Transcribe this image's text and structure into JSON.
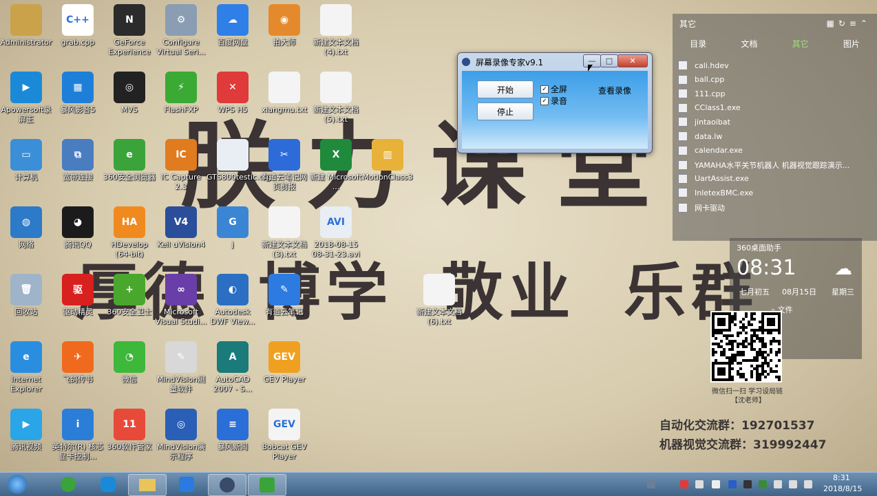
{
  "wallpaper": {
    "slogan_top": "朕力课堂",
    "slogan_bottom": "厚德 博学 敬业 乐群",
    "group1": "自动化交流群：192701537",
    "group2": "机器视觉交流群：319992447"
  },
  "desktop_icons": [
    {
      "label": "Administrator",
      "color": "#c9a24a",
      "glyph": ""
    },
    {
      "label": "grab.cpp",
      "color": "#ffffff",
      "glyph": "C++"
    },
    {
      "label": "GeForce Experience",
      "color": "#2b2b2b",
      "glyph": "N"
    },
    {
      "label": "Configure Virtual Seri...",
      "color": "#8a9db3",
      "glyph": "⚙"
    },
    {
      "label": "百度网盘",
      "color": "#2f7fe8",
      "glyph": "☁"
    },
    {
      "label": "拍大师",
      "color": "#e58a2c",
      "glyph": "◉"
    },
    {
      "label": "新建文本文档 (4).txt",
      "color": "#f4f4f4",
      "glyph": ""
    },
    {
      "label": "Apowersoft录屏王",
      "color": "#1a8ad8",
      "glyph": "▶"
    },
    {
      "label": "暴风影音5",
      "color": "#1e7fd9",
      "glyph": "▦"
    },
    {
      "label": "MVS",
      "color": "#222222",
      "glyph": "◎"
    },
    {
      "label": "FlashFXP",
      "color": "#3aaa35",
      "glyph": "⚡"
    },
    {
      "label": "WPS H5",
      "color": "#e03a3a",
      "glyph": "✕"
    },
    {
      "label": "xiangmu.txt",
      "color": "#f4f4f4",
      "glyph": ""
    },
    {
      "label": "新建文本文档 (5).txt",
      "color": "#f4f4f4",
      "glyph": ""
    },
    {
      "label": "计算机",
      "color": "#3b8fd8",
      "glyph": "▭"
    },
    {
      "label": "宽带连接",
      "color": "#4a7cc0",
      "glyph": "⧉"
    },
    {
      "label": "360安全浏览器",
      "color": "#3aa43a",
      "glyph": "e"
    },
    {
      "label": "IC Capture 2.3",
      "color": "#e07b1f",
      "glyph": "IC"
    },
    {
      "label": "GTS800testic.cfg",
      "color": "#e8eef4",
      "glyph": ""
    },
    {
      "label": "有道云笔记网页剪报",
      "color": "#2d6bd8",
      "glyph": "✂"
    },
    {
      "label": "新建 Microsoft ...",
      "color": "#1f8a3b",
      "glyph": "X"
    },
    {
      "label": "MotionClass3",
      "color": "#e8b23a",
      "glyph": "▥"
    },
    {
      "label": "网络",
      "color": "#2d7ac8",
      "glyph": "◍"
    },
    {
      "label": "腾讯QQ",
      "color": "#1b1b1b",
      "glyph": "◕"
    },
    {
      "label": "HDevelop (64-bit)",
      "color": "#f08a1e",
      "glyph": "HA"
    },
    {
      "label": "Keil uVision4",
      "color": "#2a4e9a",
      "glyph": "V4"
    },
    {
      "label": "j",
      "color": "#3a86d4",
      "glyph": "G"
    },
    {
      "label": "新建文本文档 (3).txt",
      "color": "#f4f4f4",
      "glyph": ""
    },
    {
      "label": "2018-08-15 08-31-23.avi",
      "color": "#e8eef4",
      "glyph": "AVI"
    },
    {
      "label": "回收站",
      "color": "#9fb4c8",
      "glyph": "🗑"
    },
    {
      "label": "驱动精灵",
      "color": "#d8201f",
      "glyph": "驱"
    },
    {
      "label": "360安全卫士",
      "color": "#4aa72e",
      "glyph": "+"
    },
    {
      "label": "Microsoft Visual Studi...",
      "color": "#6a3ea8",
      "glyph": "∞"
    },
    {
      "label": "Autodesk DWF View...",
      "color": "#2a6fc4",
      "glyph": "◐"
    },
    {
      "label": "有道云笔记",
      "color": "#2d7ae0",
      "glyph": "✎"
    },
    {
      "label": "新建文本文档 (6).txt",
      "color": "#f4f4f4",
      "glyph": ""
    },
    {
      "label": "Internet Explorer",
      "color": "#2a8ee0",
      "glyph": "e"
    },
    {
      "label": "飞鸽传书",
      "color": "#f06a1e",
      "glyph": "✈"
    },
    {
      "label": "微信",
      "color": "#3db83a",
      "glyph": "◔"
    },
    {
      "label": "MindVision测量软件",
      "color": "#d8d8d8",
      "glyph": "✎"
    },
    {
      "label": "AutoCAD 2007 - S...",
      "color": "#1b7a7a",
      "glyph": "A"
    },
    {
      "label": "GEV Player",
      "color": "#f0a020",
      "glyph": "GEV"
    },
    {
      "label": "腾讯视频",
      "color": "#2aa5e8",
      "glyph": "▶"
    },
    {
      "label": "英特尔(R) 核芯显卡控制...",
      "color": "#2a7ed8",
      "glyph": "i"
    },
    {
      "label": "360软件管家",
      "color": "#e84a3a",
      "glyph": "11"
    },
    {
      "label": "MindVision演示程序",
      "color": "#2a5fb8",
      "glyph": "◎"
    },
    {
      "label": "暴风新闻",
      "color": "#2a6fd8",
      "glyph": "≡"
    },
    {
      "label": "Bobcat GEV Player",
      "color": "#f4f4f4",
      "glyph": "GEV"
    }
  ],
  "recorder": {
    "title": "屏幕录像专家v9.1",
    "start": "开始",
    "stop": "停止",
    "fullscreen": "全屏",
    "audio": "录音",
    "view": "查看录像",
    "minimize": "—",
    "maximize": "□",
    "close": "✕"
  },
  "side_panel": {
    "header": "其它",
    "tabs": [
      "目录",
      "文档",
      "其它",
      "图片"
    ],
    "files": [
      "cali.hdev",
      "ball.cpp",
      "111.cpp",
      "CClass1.exe",
      "jintaoibat",
      "data.lw",
      "calendar.exe",
      "YAMAHA水平关节机器人 机器视觉跟踪演示...",
      "UartAssist.exe",
      "InletexBMC.exe",
      "网卡驱动"
    ]
  },
  "assistant": {
    "title": "360桌面助手",
    "time": "08:31",
    "lunar": "七月初五",
    "date": "08月15日",
    "weekday": "星期三",
    "search": "文件",
    "qr_caption": "微信扫一扫 学习设局链",
    "qr_sub": "【沈老师】"
  },
  "taskbar": {
    "time": "8:31",
    "date": "2018/8/15"
  }
}
